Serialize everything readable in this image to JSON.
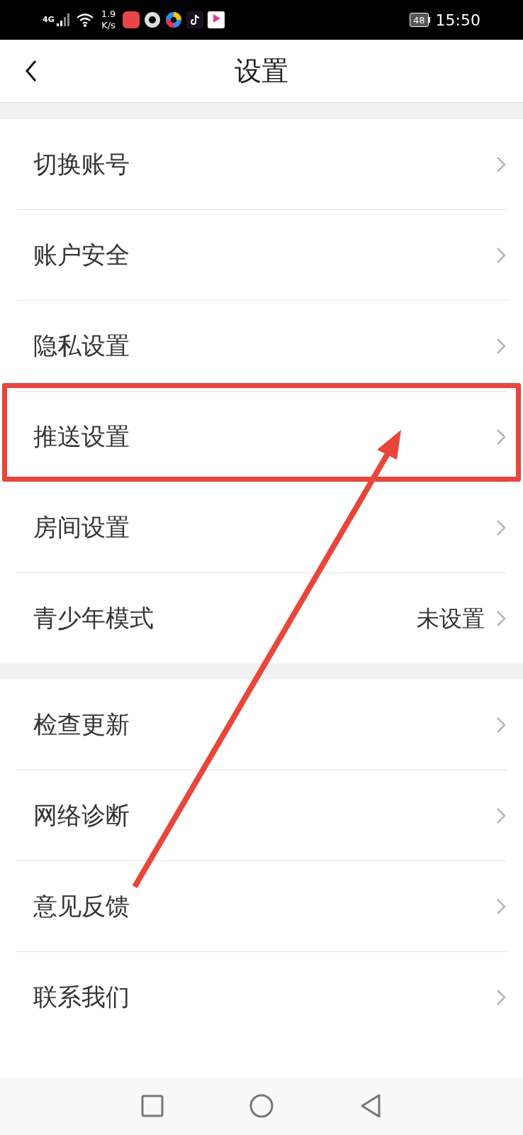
{
  "status_bar": {
    "network": "4G",
    "speed_value": "1.9",
    "speed_unit": "K/s",
    "battery": "48",
    "time": "15:50"
  },
  "header": {
    "title": "设置"
  },
  "groups": [
    {
      "items": [
        {
          "label": "切换账号"
        },
        {
          "label": "账户安全"
        },
        {
          "label": "隐私设置"
        },
        {
          "label": "推送设置",
          "highlighted": true
        },
        {
          "label": "房间设置"
        },
        {
          "label": "青少年模式",
          "value": "未设置"
        }
      ]
    },
    {
      "items": [
        {
          "label": "检查更新"
        },
        {
          "label": "网络诊断"
        },
        {
          "label": "意见反馈"
        },
        {
          "label": "联系我们"
        }
      ]
    }
  ]
}
